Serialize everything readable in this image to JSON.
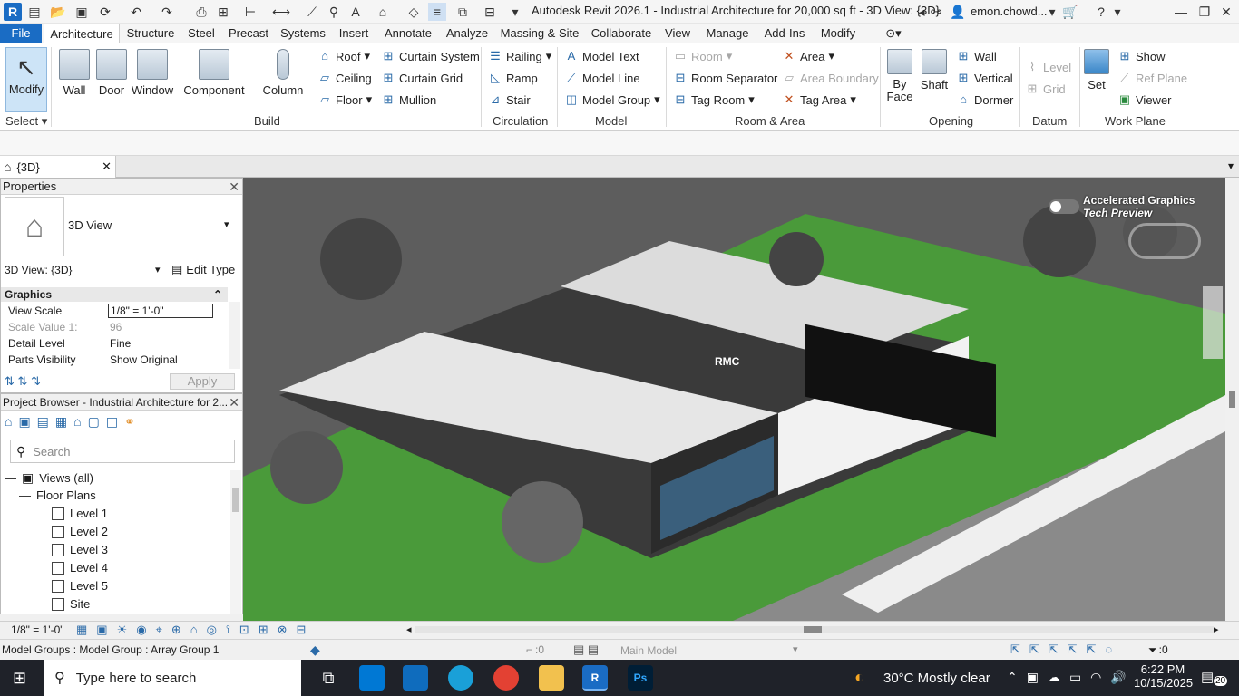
{
  "titlebar": {
    "app_title": "Autodesk Revit 2026.1 - Industrial Architecture for 20,000 sq ft - 3D View: {3D}",
    "user": "emon.chowd...",
    "logo": "R"
  },
  "tabs": [
    "File",
    "Architecture",
    "Structure",
    "Steel",
    "Precast",
    "Systems",
    "Insert",
    "Annotate",
    "Analyze",
    "Massing & Site",
    "Collaborate",
    "View",
    "Manage",
    "Add-Ins",
    "Modify"
  ],
  "ribbon": {
    "select": {
      "modify": "Modify",
      "select": "Select"
    },
    "build": {
      "wall": "Wall",
      "door": "Door",
      "window": "Window",
      "component": "Component",
      "column": "Column",
      "roof": "Roof",
      "ceiling": "Ceiling",
      "floor": "Floor",
      "curtain_system": "Curtain System",
      "curtain_grid": "Curtain Grid",
      "mullion": "Mullion",
      "group": "Build"
    },
    "circulation": {
      "railing": "Railing",
      "ramp": "Ramp",
      "stair": "Stair",
      "group": "Circulation"
    },
    "model": {
      "model_text": "Model Text",
      "model_line": "Model Line",
      "model_group": "Model Group",
      "group": "Model"
    },
    "room": {
      "room": "Room",
      "room_separator": "Room Separator",
      "tag_room": "Tag Room",
      "area": "Area",
      "area_boundary": "Area Boundary",
      "tag_area": "Tag Area",
      "group": "Room & Area"
    },
    "opening": {
      "by_face": "By Face",
      "shaft": "Shaft",
      "wall": "Wall",
      "vertical": "Vertical",
      "dormer": "Dormer",
      "group": "Opening"
    },
    "datum": {
      "level": "Level",
      "grid": "Grid",
      "group": "Datum"
    },
    "workplane": {
      "set": "Set",
      "show": "Show",
      "ref_plane": "Ref Plane",
      "viewer": "Viewer",
      "group": "Work Plane"
    }
  },
  "view_tab": {
    "label": "{3D}"
  },
  "properties": {
    "title": "Properties",
    "type_name": "3D View",
    "selector": "3D View: {3D}",
    "edit_type": "Edit Type",
    "section": "Graphics",
    "rows": [
      {
        "k": "View Scale",
        "v": "1/8\" = 1'-0\""
      },
      {
        "k": "Scale Value   1:",
        "v": "96"
      },
      {
        "k": "Detail Level",
        "v": "Fine"
      },
      {
        "k": "Parts Visibility",
        "v": "Show Original"
      }
    ],
    "apply": "Apply"
  },
  "browser": {
    "title": "Project Browser - Industrial Architecture for 2...",
    "search_placeholder": "Search",
    "root": "Views (all)",
    "folder": "Floor Plans",
    "items": [
      "Level 1",
      "Level 2",
      "Level 3",
      "Level 4",
      "Level 5",
      "Site"
    ]
  },
  "viewport": {
    "overlay_title": "Accelerated Graphics",
    "overlay_sub": "Tech Preview",
    "sign": "RMC"
  },
  "view_controls": {
    "scale": "1/8\" = 1'-0\""
  },
  "status": {
    "message": "Model Groups : Model Group : Array Group 1",
    "worksets": ":0",
    "model": "Main Model",
    "filter": ":0"
  },
  "taskbar": {
    "search": "Type here to search",
    "weather": "30°C  Mostly clear",
    "time": "6:22 PM",
    "date": "10/15/2025",
    "notif": "20"
  },
  "colors": {
    "file_tab": "#1a6cc4",
    "taskbar": "#1f2229",
    "grass": "#4a9a3a"
  }
}
